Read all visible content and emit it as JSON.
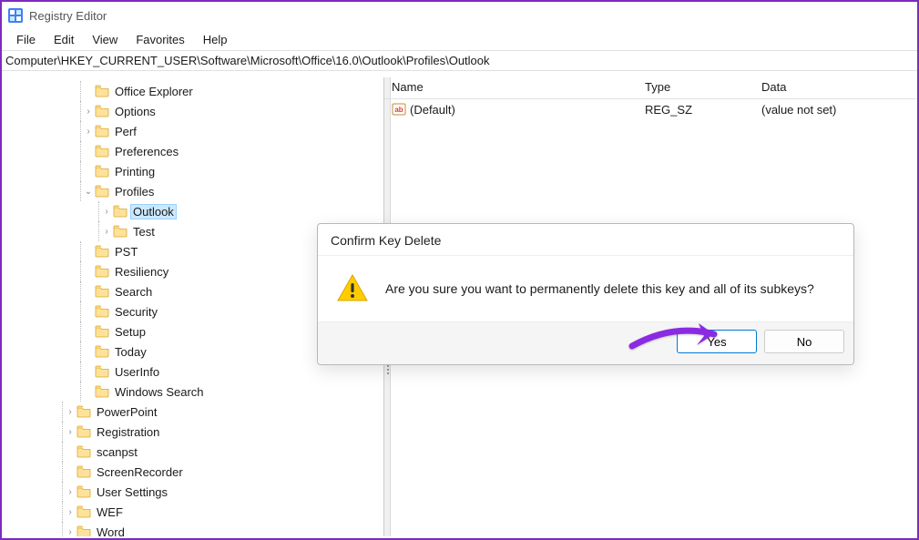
{
  "window": {
    "title": "Registry Editor"
  },
  "menus": [
    "File",
    "Edit",
    "View",
    "Favorites",
    "Help"
  ],
  "address": "Computer\\HKEY_CURRENT_USER\\Software\\Microsoft\\Office\\16.0\\Outlook\\Profiles\\Outlook",
  "tree": {
    "indent_base": 86,
    "items": [
      {
        "label": "Office Explorer",
        "depth": 0,
        "hasChildren": false
      },
      {
        "label": "Options",
        "depth": 0,
        "hasChildren": true
      },
      {
        "label": "Perf",
        "depth": 0,
        "hasChildren": true
      },
      {
        "label": "Preferences",
        "depth": 0,
        "hasChildren": false
      },
      {
        "label": "Printing",
        "depth": 0,
        "hasChildren": false
      },
      {
        "label": "Profiles",
        "depth": 0,
        "hasChildren": true,
        "expanded": true
      },
      {
        "label": "Outlook",
        "depth": 1,
        "hasChildren": true,
        "selected": true
      },
      {
        "label": "Test",
        "depth": 1,
        "hasChildren": true
      },
      {
        "label": "PST",
        "depth": 0,
        "hasChildren": false
      },
      {
        "label": "Resiliency",
        "depth": 0,
        "hasChildren": false
      },
      {
        "label": "Search",
        "depth": 0,
        "hasChildren": false
      },
      {
        "label": "Security",
        "depth": 0,
        "hasChildren": false
      },
      {
        "label": "Setup",
        "depth": 0,
        "hasChildren": false
      },
      {
        "label": "Today",
        "depth": 0,
        "hasChildren": false
      },
      {
        "label": "UserInfo",
        "depth": 0,
        "hasChildren": false
      },
      {
        "label": "Windows Search",
        "depth": 0,
        "hasChildren": false
      },
      {
        "label": "PowerPoint",
        "depth": -1,
        "hasChildren": true
      },
      {
        "label": "Registration",
        "depth": -1,
        "hasChildren": true
      },
      {
        "label": "scanpst",
        "depth": -1,
        "hasChildren": false
      },
      {
        "label": "ScreenRecorder",
        "depth": -1,
        "hasChildren": false
      },
      {
        "label": "User Settings",
        "depth": -1,
        "hasChildren": true
      },
      {
        "label": "WEF",
        "depth": -1,
        "hasChildren": true
      },
      {
        "label": "Word",
        "depth": -1,
        "hasChildren": true
      }
    ]
  },
  "list": {
    "columns": {
      "name": "Name",
      "type": "Type",
      "data": "Data"
    },
    "rows": [
      {
        "name": "(Default)",
        "type": "REG_SZ",
        "data": "(value not set)"
      }
    ]
  },
  "dialog": {
    "title": "Confirm Key Delete",
    "message": "Are you sure you want to permanently delete this key and all of its subkeys?",
    "yes": "Yes",
    "no": "No"
  },
  "colors": {
    "outer_border": "#7b2cbf",
    "selection": "#cce8ff",
    "folder_fill": "#ffe29a",
    "folder_stroke": "#d9a62e",
    "arrow": "#8a2be2"
  }
}
